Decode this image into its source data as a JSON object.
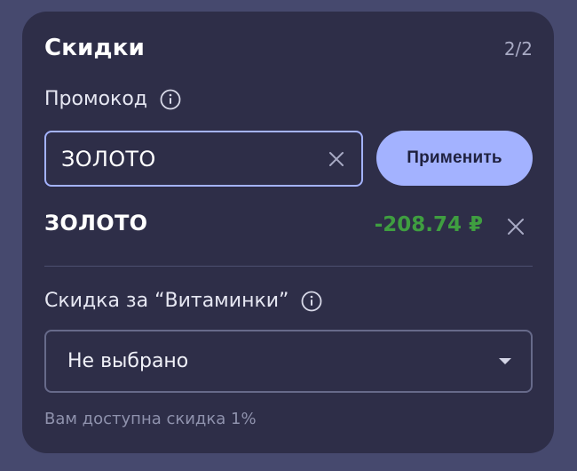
{
  "card": {
    "title": "Скидки",
    "counter": "2/2"
  },
  "promo": {
    "label": "Промокод",
    "input_value": "ЗОЛОТО",
    "apply_label": "Применить",
    "applied_code": "ЗОЛОТО",
    "applied_amount": "-208.74 ₽"
  },
  "vitamins": {
    "label": "Скидка за “Витаминки”",
    "selected": "Не выбрано",
    "hint": "Вам доступна скидка 1%"
  },
  "icons": {
    "info": "info-icon",
    "clear": "close-icon",
    "remove": "close-icon",
    "dropdown": "chevron-down-icon"
  },
  "colors": {
    "background": "#46496e",
    "card": "#2e2e48",
    "accent": "#a3b2ff",
    "discount": "#3f9e40"
  }
}
